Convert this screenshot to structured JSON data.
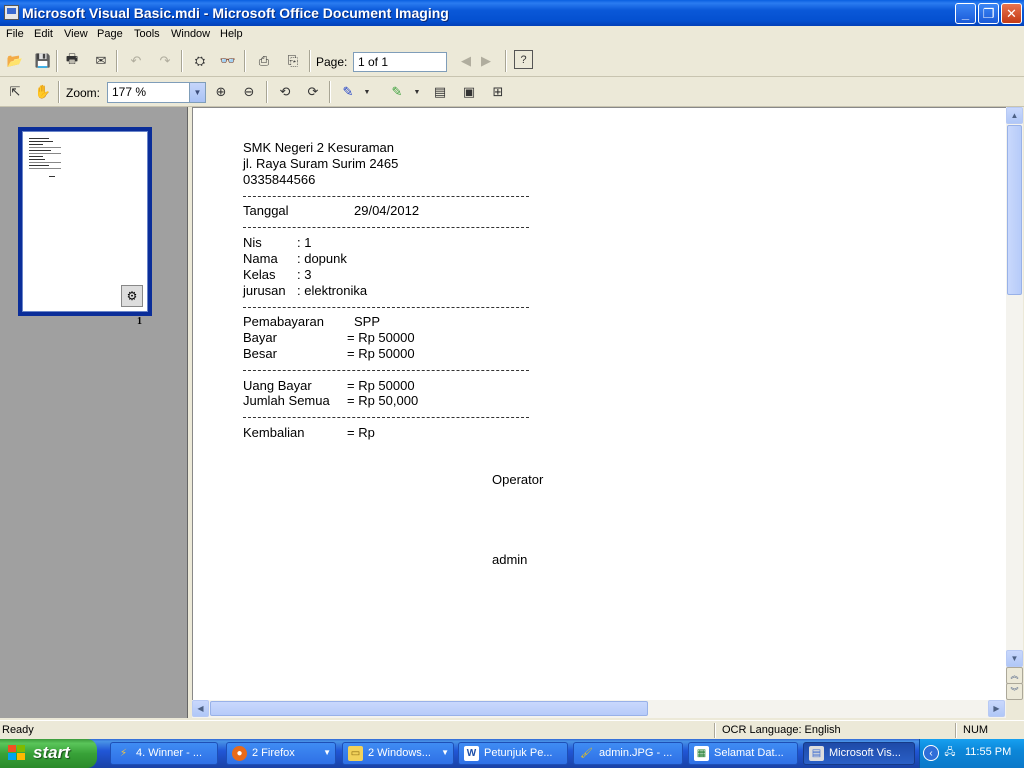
{
  "window": {
    "title": "Microsoft Visual Basic.mdi - Microsoft Office Document Imaging",
    "controls": {
      "minimize": "_",
      "restore": "❐",
      "close": "✕"
    }
  },
  "menu": [
    "File",
    "Edit",
    "View",
    "Page",
    "Tools",
    "Window",
    "Help"
  ],
  "toolbar1": {
    "page_label": "Page:",
    "page_value": "1 of 1"
  },
  "toolbar2": {
    "zoom_label": "Zoom:",
    "zoom_value": "177 %"
  },
  "thumbnail": {
    "page_number": "1"
  },
  "document": {
    "school": "SMK Negeri 2 Kesuraman",
    "address": "jl. Raya Suram Surim 2465",
    "phone": "0335844566",
    "dash_line": "------------------------------------------------------------",
    "tanggal": {
      "label": "Tanggal",
      "value": "29/04/2012"
    },
    "student": [
      {
        "label": "Nis",
        "value": ": 1"
      },
      {
        "label": "Nama",
        "value": ": dopunk"
      },
      {
        "label": "Kelas",
        "value": ": 3"
      },
      {
        "label": "jurusan",
        "value": ": elektronika"
      }
    ],
    "payment": {
      "pembayaran_label": "Pemabayaran",
      "pembayaran_value": "SPP",
      "bayar_label": "Bayar",
      "bayar_value": "= Rp 50000",
      "besar_label": "Besar",
      "besar_value": "= Rp 50000"
    },
    "totals": {
      "uang_label": "Uang Bayar",
      "uang_value": "= Rp 50000",
      "jumlah_label": "Jumlah Semua",
      "jumlah_value": "= Rp 50,000"
    },
    "kembalian": {
      "label": "Kembalian",
      "value": "= Rp"
    },
    "operator_label": "Operator",
    "operator_name": "admin"
  },
  "status": {
    "state": "Ready",
    "ocr": "OCR Language: English",
    "num": "NUM"
  },
  "taskbar": {
    "start": "start",
    "tasks": [
      {
        "label": "4. Winner - ...",
        "icon": "winamp-icon"
      },
      {
        "label": "2 Firefox",
        "icon": "firefox-icon"
      },
      {
        "label": "2 Windows...",
        "icon": "folder-icon"
      },
      {
        "label": "Petunjuk Pe...",
        "icon": "word-icon"
      },
      {
        "label": "admin.JPG - ...",
        "icon": "paint-icon"
      },
      {
        "label": "Selamat Dat...",
        "icon": "app-icon"
      },
      {
        "label": "Microsoft Vis...",
        "icon": "mdi-icon"
      }
    ],
    "clock": "11:55 PM"
  },
  "colors": {
    "titlebar": "#0a58d8",
    "taskbar": "#2157d7",
    "start_green": "#38a238",
    "tray": "#0c87d9",
    "thumb_border": "#0a2d99"
  }
}
